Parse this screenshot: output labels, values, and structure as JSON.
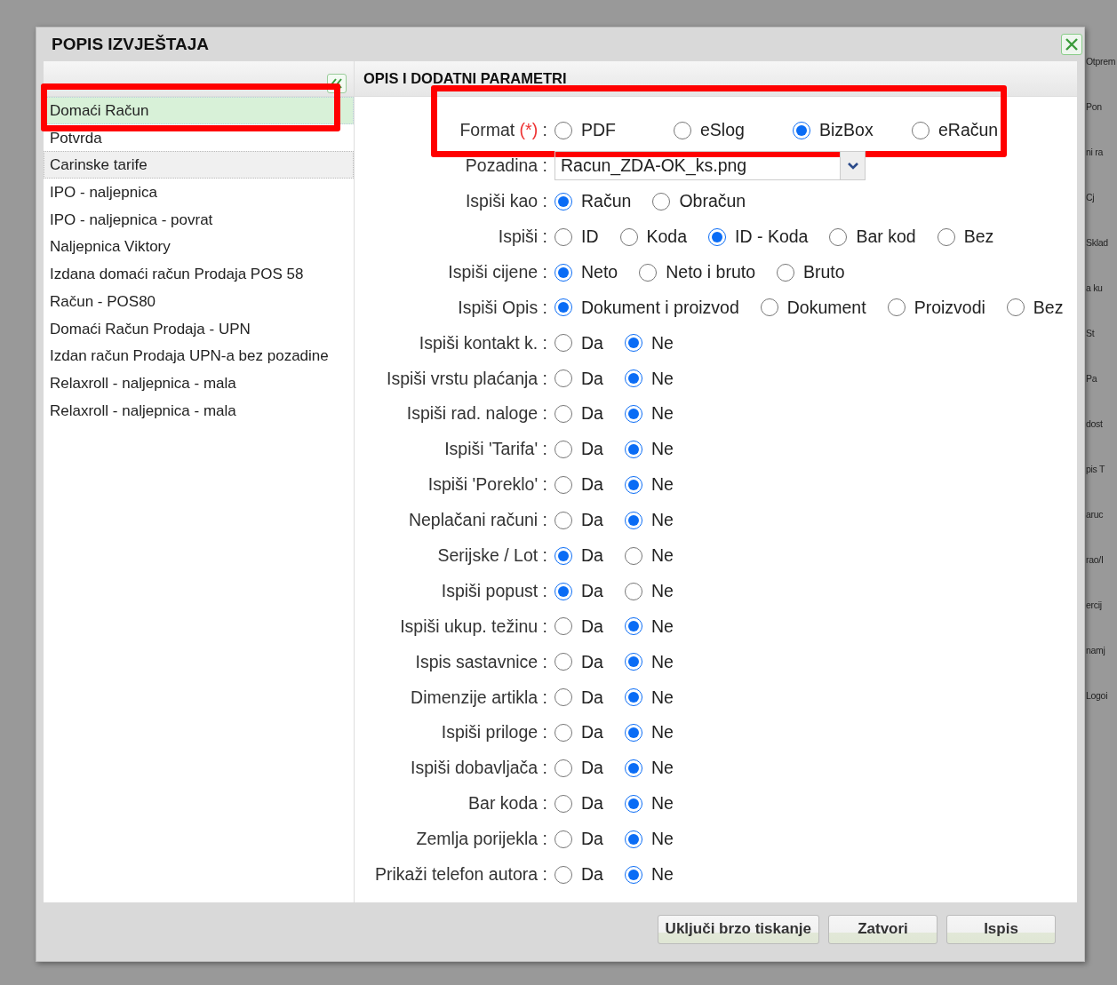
{
  "dialog": {
    "title": "POPIS IZVJEŠTAJA"
  },
  "report_list": {
    "items": [
      {
        "label": "Domaći Račun",
        "selected": true,
        "hovered": false,
        "highlighted": true
      },
      {
        "label": "Potvrda",
        "selected": false,
        "hovered": false,
        "highlighted": false
      },
      {
        "label": "Carinske tarife",
        "selected": false,
        "hovered": true,
        "highlighted": false
      },
      {
        "label": "IPO - naljepnica",
        "selected": false,
        "hovered": false,
        "highlighted": false
      },
      {
        "label": "IPO - naljepnica - povrat",
        "selected": false,
        "hovered": false,
        "highlighted": false
      },
      {
        "label": "Naljepnica Viktory",
        "selected": false,
        "hovered": false,
        "highlighted": false
      },
      {
        "label": "Izdana domaći račun Prodaja POS 58",
        "selected": false,
        "hovered": false,
        "highlighted": false
      },
      {
        "label": "Račun - POS80",
        "selected": false,
        "hovered": false,
        "highlighted": false
      },
      {
        "label": "Domaći Račun Prodaja - UPN",
        "selected": false,
        "hovered": false,
        "highlighted": false
      },
      {
        "label": "Izdan račun Prodaja UPN-a bez pozadine",
        "selected": false,
        "hovered": false,
        "highlighted": false
      },
      {
        "label": "Relaxroll - naljepnica - mala",
        "selected": false,
        "hovered": false,
        "highlighted": false
      },
      {
        "label": "Relaxroll - naljepnica - mala",
        "selected": false,
        "hovered": false,
        "highlighted": false
      }
    ]
  },
  "parameters": {
    "title": "OPIS I DODATNI PARAMETRI",
    "rows": [
      {
        "kind": "radio",
        "label": "Format",
        "required_mark": "(*)",
        "label_end": ":",
        "highlighted": true,
        "options": [
          {
            "label": "PDF",
            "selected": false
          },
          {
            "label": "eSlog",
            "selected": false
          },
          {
            "label": "BizBox",
            "selected": true
          },
          {
            "label": "eRačun",
            "selected": false
          }
        ]
      },
      {
        "kind": "select",
        "label": "Pozadina",
        "label_end": ":",
        "value": "Racun_ZDA-OK_ks.png"
      },
      {
        "kind": "radio",
        "label": "Ispiši kao",
        "label_end": ":",
        "options": [
          {
            "label": "Račun",
            "selected": true
          },
          {
            "label": "Obračun",
            "selected": false
          }
        ]
      },
      {
        "kind": "radio",
        "label": "Ispiši",
        "label_end": ":",
        "options": [
          {
            "label": "ID",
            "selected": false
          },
          {
            "label": "Koda",
            "selected": false
          },
          {
            "label": "ID - Koda",
            "selected": true
          },
          {
            "label": "Bar kod",
            "selected": false
          },
          {
            "label": "Bez",
            "selected": false
          }
        ]
      },
      {
        "kind": "radio",
        "label": "Ispiši cijene",
        "label_end": ":",
        "options": [
          {
            "label": "Neto",
            "selected": true
          },
          {
            "label": "Neto i bruto",
            "selected": false
          },
          {
            "label": "Bruto",
            "selected": false
          }
        ]
      },
      {
        "kind": "radio",
        "label": "Ispiši Opis",
        "label_end": ":",
        "options": [
          {
            "label": "Dokument i proizvod",
            "selected": true
          },
          {
            "label": "Dokument",
            "selected": false
          },
          {
            "label": "Proizvodi",
            "selected": false
          },
          {
            "label": "Bez",
            "selected": false
          }
        ]
      },
      {
        "kind": "radio",
        "label": "Ispiši kontakt k.",
        "label_end": ":",
        "options": [
          {
            "label": "Da",
            "selected": false
          },
          {
            "label": "Ne",
            "selected": true
          }
        ]
      },
      {
        "kind": "radio",
        "label": "Ispiši vrstu plaćanja",
        "label_end": ":",
        "options": [
          {
            "label": "Da",
            "selected": false
          },
          {
            "label": "Ne",
            "selected": true
          }
        ]
      },
      {
        "kind": "radio",
        "label": "Ispiši rad. naloge",
        "label_end": ":",
        "options": [
          {
            "label": "Da",
            "selected": false
          },
          {
            "label": "Ne",
            "selected": true
          }
        ]
      },
      {
        "kind": "radio",
        "label": "Ispiši 'Tarifa'",
        "label_end": ":",
        "options": [
          {
            "label": "Da",
            "selected": false
          },
          {
            "label": "Ne",
            "selected": true
          }
        ]
      },
      {
        "kind": "radio",
        "label": "Ispiši 'Poreklo'",
        "label_end": ":",
        "options": [
          {
            "label": "Da",
            "selected": false
          },
          {
            "label": "Ne",
            "selected": true
          }
        ]
      },
      {
        "kind": "radio",
        "label": "Neplačani računi",
        "label_end": ":",
        "options": [
          {
            "label": "Da",
            "selected": false
          },
          {
            "label": "Ne",
            "selected": true
          }
        ]
      },
      {
        "kind": "radio",
        "label": "Serijske / Lot",
        "label_end": ":",
        "options": [
          {
            "label": "Da",
            "selected": true
          },
          {
            "label": "Ne",
            "selected": false
          }
        ]
      },
      {
        "kind": "radio",
        "label": "Ispiši popust",
        "label_end": ":",
        "options": [
          {
            "label": "Da",
            "selected": true
          },
          {
            "label": "Ne",
            "selected": false
          }
        ]
      },
      {
        "kind": "radio",
        "label": "Ispiši ukup. težinu",
        "label_end": ":",
        "options": [
          {
            "label": "Da",
            "selected": false
          },
          {
            "label": "Ne",
            "selected": true
          }
        ]
      },
      {
        "kind": "radio",
        "label": "Ispis sastavnice",
        "label_end": ":",
        "options": [
          {
            "label": "Da",
            "selected": false
          },
          {
            "label": "Ne",
            "selected": true
          }
        ]
      },
      {
        "kind": "radio",
        "label": "Dimenzije artikla",
        "label_end": ":",
        "options": [
          {
            "label": "Da",
            "selected": false
          },
          {
            "label": "Ne",
            "selected": true
          }
        ]
      },
      {
        "kind": "radio",
        "label": "Ispiši priloge",
        "label_end": ":",
        "options": [
          {
            "label": "Da",
            "selected": false
          },
          {
            "label": "Ne",
            "selected": true
          }
        ]
      },
      {
        "kind": "radio",
        "label": "Ispiši dobavljača",
        "label_end": ":",
        "options": [
          {
            "label": "Da",
            "selected": false
          },
          {
            "label": "Ne",
            "selected": true
          }
        ]
      },
      {
        "kind": "radio",
        "label": "Bar koda",
        "label_end": ":",
        "options": [
          {
            "label": "Da",
            "selected": false
          },
          {
            "label": "Ne",
            "selected": true
          }
        ]
      },
      {
        "kind": "radio",
        "label": "Zemlja porijekla",
        "label_end": ":",
        "options": [
          {
            "label": "Da",
            "selected": false
          },
          {
            "label": "Ne",
            "selected": true
          }
        ]
      },
      {
        "kind": "radio",
        "label": "Prikaži telefon autora",
        "label_end": ":",
        "options": [
          {
            "label": "Da",
            "selected": false
          },
          {
            "label": "Ne",
            "selected": true
          }
        ]
      }
    ]
  },
  "buttons": [
    "Uključi brzo tiskanje",
    "Zatvori",
    "Ispis"
  ],
  "background_labels": [
    "Otprem",
    "Pon",
    "ni ra",
    "Cj",
    "Sklad",
    "a ku",
    "St",
    "Pa",
    "dost",
    "pis T",
    "aruc",
    "rao/I",
    "ercij",
    "namj",
    "Logoi"
  ]
}
